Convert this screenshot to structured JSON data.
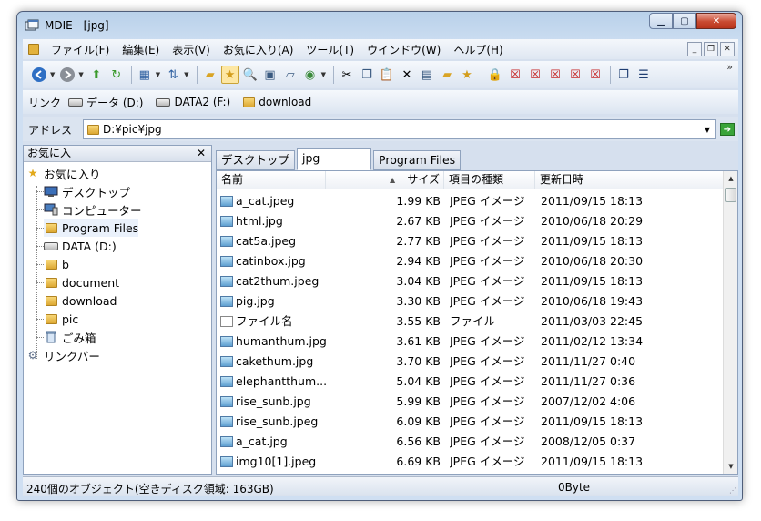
{
  "window": {
    "title": "MDIE - [jpg]"
  },
  "menu": [
    "ファイル(F)",
    "編集(E)",
    "表示(V)",
    "お気に入り(A)",
    "ツール(T)",
    "ウインドウ(W)",
    "ヘルプ(H)"
  ],
  "toolbar": {
    "icons": [
      "back-icon",
      "forward-icon",
      "up-folder-icon",
      "refresh-icon",
      "view-mode-icon",
      "sort-icon",
      "folder-icon",
      "favorites-star-icon",
      "search-icon",
      "preview-icon",
      "eraser-icon",
      "globe-icon",
      "cut-icon",
      "copy-icon",
      "paste-icon",
      "delete-icon",
      "properties-icon",
      "new-folder-icon",
      "favorite-add-icon",
      "lock-icon",
      "close-window-icon",
      "close-all-icon",
      "close-others-icon",
      "close-left-icon",
      "close-right-icon",
      "cascade-icon",
      "tile-icon"
    ]
  },
  "links": {
    "label": "リンク",
    "items": [
      {
        "label": "データ (D:)",
        "icon": "drive-icon"
      },
      {
        "label": "DATA2 (F:)",
        "icon": "drive-icon"
      },
      {
        "label": "download",
        "icon": "folder-icon"
      }
    ]
  },
  "address": {
    "label": "アドレス",
    "value": "D:¥pic¥jpg"
  },
  "favorites_pane": {
    "title": "お気に入",
    "close": "✕",
    "items": [
      {
        "label": "お気に入り",
        "icon": "star-icon",
        "depth": 0
      },
      {
        "label": "デスクトップ",
        "icon": "desktop-icon",
        "depth": 1
      },
      {
        "label": "コンピューター",
        "icon": "computer-icon",
        "depth": 1
      },
      {
        "label": "Program Files",
        "icon": "folder-icon",
        "depth": 1
      },
      {
        "label": "DATA (D:)",
        "icon": "drive-icon",
        "depth": 1
      },
      {
        "label": "b",
        "icon": "folder-icon",
        "depth": 1
      },
      {
        "label": "document",
        "icon": "folder-icon",
        "depth": 1
      },
      {
        "label": "download",
        "icon": "folder-icon",
        "depth": 1
      },
      {
        "label": "pic",
        "icon": "folder-icon",
        "depth": 1
      },
      {
        "label": "ごみ箱",
        "icon": "recycle-bin-icon",
        "depth": 1
      },
      {
        "label": "リンクバー",
        "icon": "gear-icon",
        "depth": 0
      }
    ]
  },
  "tabs": [
    "デスクトップ",
    "jpg",
    "Program Files"
  ],
  "columns": [
    "名前",
    "サイズ",
    "項目の種類",
    "更新日時"
  ],
  "files": [
    {
      "name": "a_cat.jpeg",
      "size": "1.99 KB",
      "type": "JPEG イメージ",
      "date": "2011/09/15 18:13"
    },
    {
      "name": "html.jpg",
      "size": "2.67 KB",
      "type": "JPEG イメージ",
      "date": "2010/06/18 20:29"
    },
    {
      "name": "cat5a.jpeg",
      "size": "2.77 KB",
      "type": "JPEG イメージ",
      "date": "2011/09/15 18:13"
    },
    {
      "name": "catinbox.jpg",
      "size": "2.94 KB",
      "type": "JPEG イメージ",
      "date": "2010/06/18 20:30"
    },
    {
      "name": "cat2thum.jpeg",
      "size": "3.04 KB",
      "type": "JPEG イメージ",
      "date": "2011/09/15 18:13"
    },
    {
      "name": "pig.jpg",
      "size": "3.30 KB",
      "type": "JPEG イメージ",
      "date": "2010/06/18 19:43"
    },
    {
      "name": "ファイル名",
      "size": "3.55 KB",
      "type": "ファイル",
      "date": "2011/03/03 22:45"
    },
    {
      "name": "humanthum.jpg",
      "size": "3.61 KB",
      "type": "JPEG イメージ",
      "date": "2011/02/12 13:34"
    },
    {
      "name": "cakethum.jpg",
      "size": "3.70 KB",
      "type": "JPEG イメージ",
      "date": "2011/11/27 0:40"
    },
    {
      "name": "elephantthum...",
      "size": "5.04 KB",
      "type": "JPEG イメージ",
      "date": "2011/11/27 0:36"
    },
    {
      "name": "rise_sunb.jpg",
      "size": "5.99 KB",
      "type": "JPEG イメージ",
      "date": "2007/12/02 4:06"
    },
    {
      "name": "rise_sunb.jpeg",
      "size": "6.09 KB",
      "type": "JPEG イメージ",
      "date": "2011/09/15 18:13"
    },
    {
      "name": "a_cat.jpg",
      "size": "6.56 KB",
      "type": "JPEG イメージ",
      "date": "2008/12/05 0:37"
    },
    {
      "name": "img10[1].jpeg",
      "size": "6.69 KB",
      "type": "JPEG イメージ",
      "date": "2011/09/15 18:13"
    }
  ],
  "status": {
    "objects": "240個のオブジェクト(空きディスク領域: 163GB)",
    "size": "0Byte"
  }
}
